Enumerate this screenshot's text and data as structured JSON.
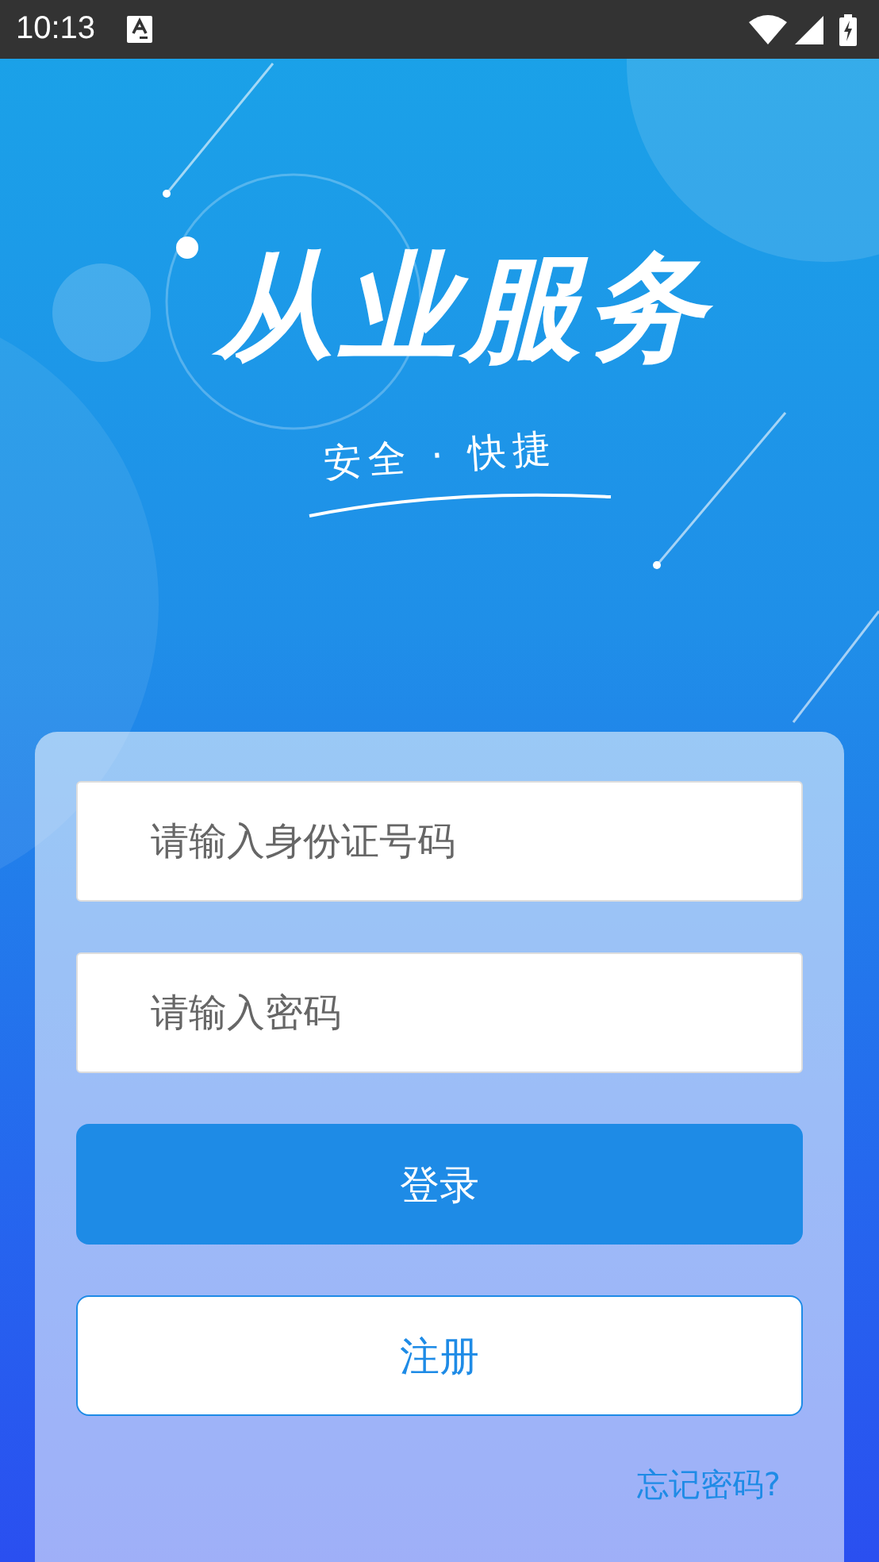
{
  "status_bar": {
    "time": "10:13"
  },
  "header": {
    "title": "从业服务",
    "subtitle": "安全 · 快捷"
  },
  "form": {
    "fields": [
      {
        "placeholder": "请输入身份证号码"
      },
      {
        "placeholder": "请输入密码"
      }
    ],
    "buttons": [
      {
        "kind": "primary",
        "label": "登录"
      },
      {
        "kind": "outline",
        "label": "注册"
      }
    ],
    "forgot_link": "忘记密码?"
  }
}
